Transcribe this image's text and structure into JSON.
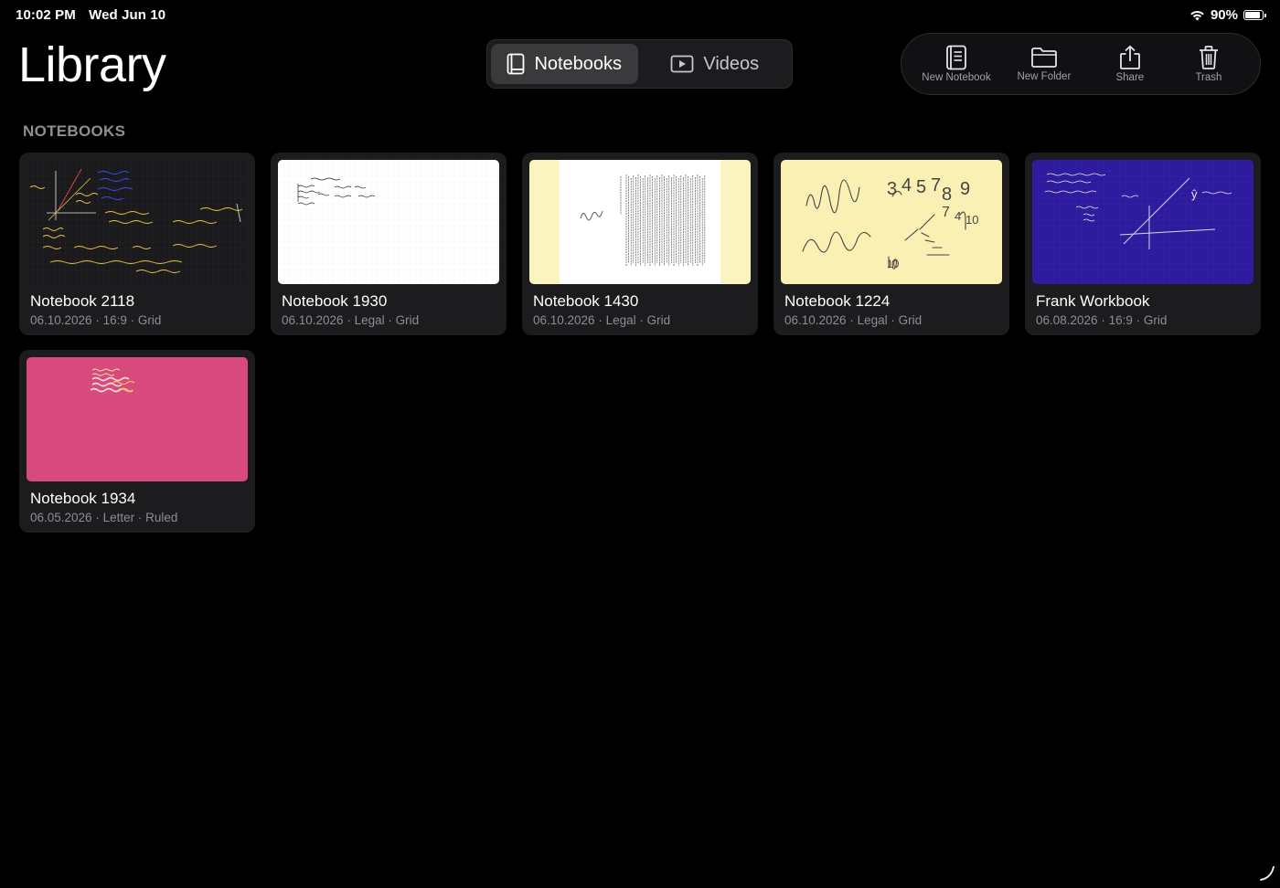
{
  "status_bar": {
    "time": "10:02 PM",
    "date": "Wed Jun 10",
    "battery": "90%",
    "battery_level": 0.9
  },
  "page": {
    "title": "Library"
  },
  "segments": [
    {
      "label": "Notebooks",
      "icon": "book-icon",
      "selected": true
    },
    {
      "label": "Videos",
      "icon": "play-rectangle-icon",
      "selected": false
    }
  ],
  "toolbar": {
    "new_notebook": "New Notebook",
    "new_folder": "New Folder",
    "share": "Share",
    "trash": "Trash"
  },
  "section": {
    "title": "NOTEBOOKS"
  },
  "notebooks": [
    {
      "title": "Notebook 2118",
      "meta": "06.10.2026 · 16:9 · Grid",
      "paper_color": "#1a1a1c"
    },
    {
      "title": "Notebook 1930",
      "meta": "06.10.2026 · Legal · Grid",
      "paper_color": "#ffffff"
    },
    {
      "title": "Notebook 1430",
      "meta": "06.10.2026 · Legal · Grid",
      "paper_color": "#fbf4c0"
    },
    {
      "title": "Notebook 1224",
      "meta": "06.10.2026 · Legal · Grid",
      "paper_color": "#fbf0b3"
    },
    {
      "title": "Frank Workbook",
      "meta": "06.08.2026 · 16:9 · Grid",
      "paper_color": "#2e1a9c"
    },
    {
      "title": "Notebook 1934",
      "meta": "06.05.2026 · Letter · Ruled",
      "paper_color": "#d84a7c"
    }
  ]
}
